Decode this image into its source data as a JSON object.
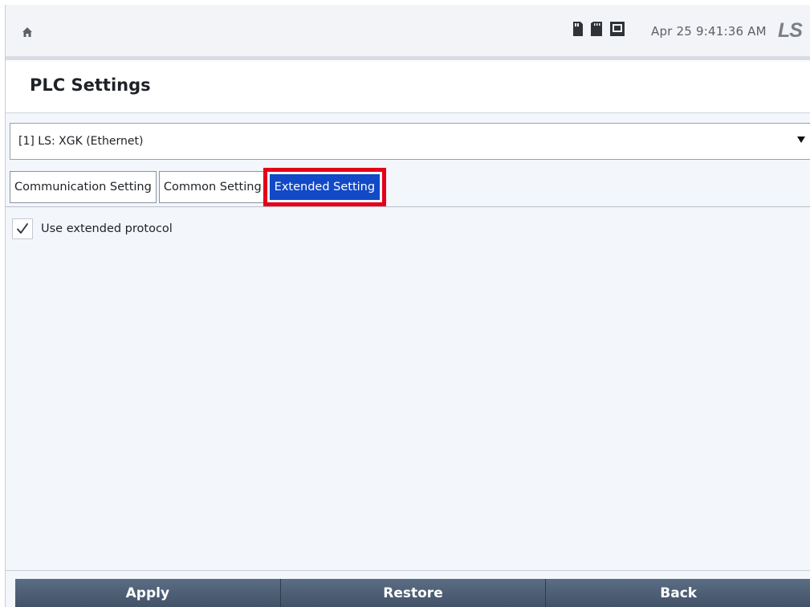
{
  "status_bar": {
    "home_icon": "home-icon",
    "status_icons": [
      "sd-card-icon",
      "memory-card-icon",
      "network-icon"
    ],
    "datetime": "Apr 25 9:41:36 AM",
    "brand": "LS"
  },
  "page": {
    "title": "PLC Settings"
  },
  "plc_select": {
    "value": "[1] LS: XGK (Ethernet)"
  },
  "tabs": [
    {
      "label": "Communication Setting",
      "active": false
    },
    {
      "label": "Common Setting",
      "active": false
    },
    {
      "label": "Extended Setting",
      "active": true
    }
  ],
  "extended": {
    "use_extended_protocol": {
      "label": "Use extended protocol",
      "checked": true
    }
  },
  "buttons": {
    "apply": "Apply",
    "restore": "Restore",
    "back": "Back"
  },
  "colors": {
    "active_tab": "#1249c7",
    "highlight": "#e5001a",
    "button_bar": "#4e5f74"
  }
}
